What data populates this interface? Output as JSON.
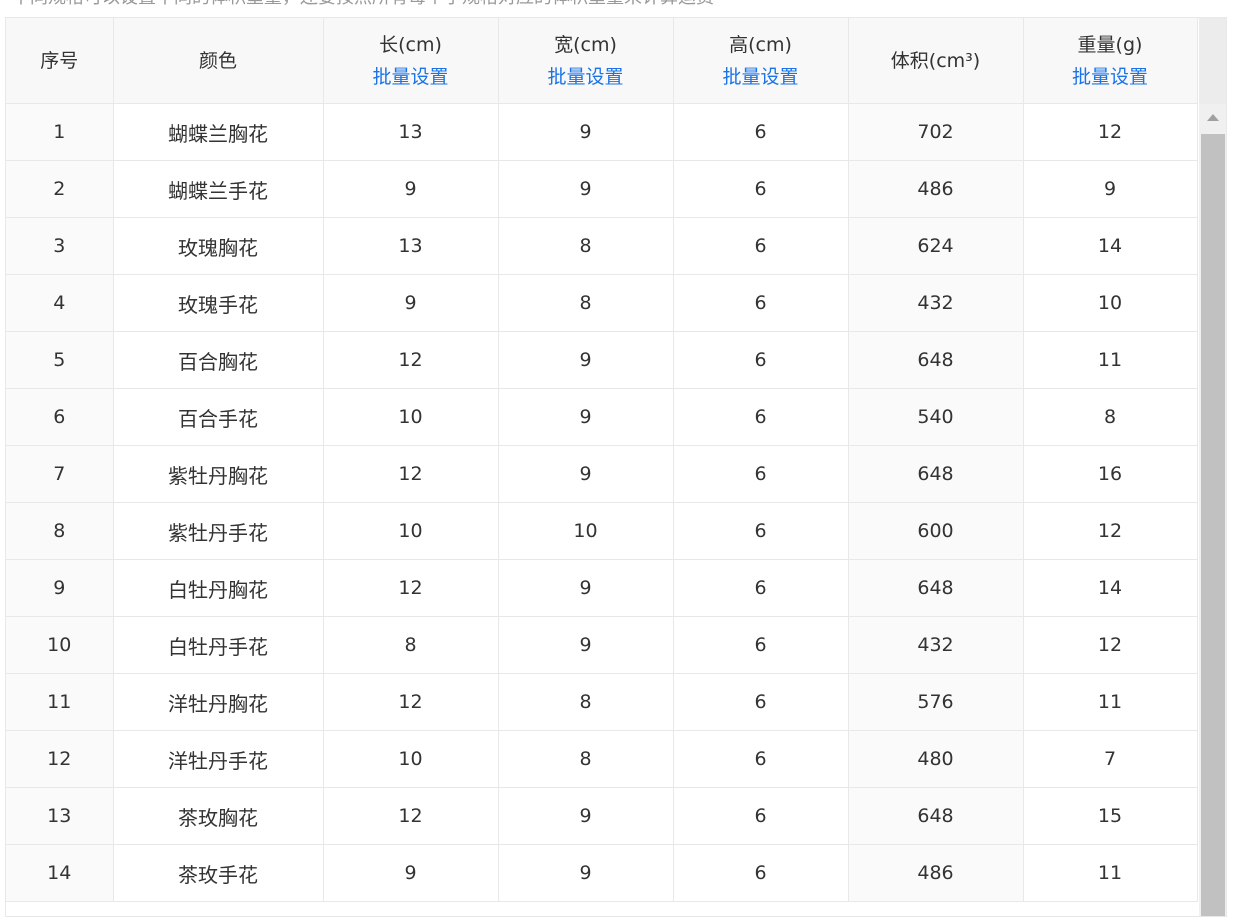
{
  "top_note": "不同规格可以设置不同的体积重量，还要按照所有每个子规格对应的体积重量来计算运费",
  "headers": {
    "index": "序号",
    "color": "颜色",
    "length": "长(cm)",
    "width": "宽(cm)",
    "height": "高(cm)",
    "volume": "体积(cm³)",
    "weight": "重量(g)",
    "batch_set": "批量设置"
  },
  "rows": [
    {
      "index": "1",
      "color": "蝴蝶兰胸花",
      "length": "13",
      "width": "9",
      "height": "6",
      "volume": "702",
      "weight": "12"
    },
    {
      "index": "2",
      "color": "蝴蝶兰手花",
      "length": "9",
      "width": "9",
      "height": "6",
      "volume": "486",
      "weight": "9"
    },
    {
      "index": "3",
      "color": "玫瑰胸花",
      "length": "13",
      "width": "8",
      "height": "6",
      "volume": "624",
      "weight": "14"
    },
    {
      "index": "4",
      "color": "玫瑰手花",
      "length": "9",
      "width": "8",
      "height": "6",
      "volume": "432",
      "weight": "10"
    },
    {
      "index": "5",
      "color": "百合胸花",
      "length": "12",
      "width": "9",
      "height": "6",
      "volume": "648",
      "weight": "11"
    },
    {
      "index": "6",
      "color": "百合手花",
      "length": "10",
      "width": "9",
      "height": "6",
      "volume": "540",
      "weight": "8"
    },
    {
      "index": "7",
      "color": "紫牡丹胸花",
      "length": "12",
      "width": "9",
      "height": "6",
      "volume": "648",
      "weight": "16"
    },
    {
      "index": "8",
      "color": "紫牡丹手花",
      "length": "10",
      "width": "10",
      "height": "6",
      "volume": "600",
      "weight": "12"
    },
    {
      "index": "9",
      "color": "白牡丹胸花",
      "length": "12",
      "width": "9",
      "height": "6",
      "volume": "648",
      "weight": "14"
    },
    {
      "index": "10",
      "color": "白牡丹手花",
      "length": "8",
      "width": "9",
      "height": "6",
      "volume": "432",
      "weight": "12"
    },
    {
      "index": "11",
      "color": "洋牡丹胸花",
      "length": "12",
      "width": "8",
      "height": "6",
      "volume": "576",
      "weight": "11"
    },
    {
      "index": "12",
      "color": "洋牡丹手花",
      "length": "10",
      "width": "8",
      "height": "6",
      "volume": "480",
      "weight": "7"
    },
    {
      "index": "13",
      "color": "茶玫胸花",
      "length": "12",
      "width": "9",
      "height": "6",
      "volume": "648",
      "weight": "15"
    },
    {
      "index": "14",
      "color": "茶玫手花",
      "length": "9",
      "width": "9",
      "height": "6",
      "volume": "486",
      "weight": "11"
    }
  ],
  "colors": {
    "link": "#1a73e8",
    "header_bg": "#f8f8f8",
    "border": "#e8e8e8",
    "scroll_thumb": "#c1c1c1"
  }
}
